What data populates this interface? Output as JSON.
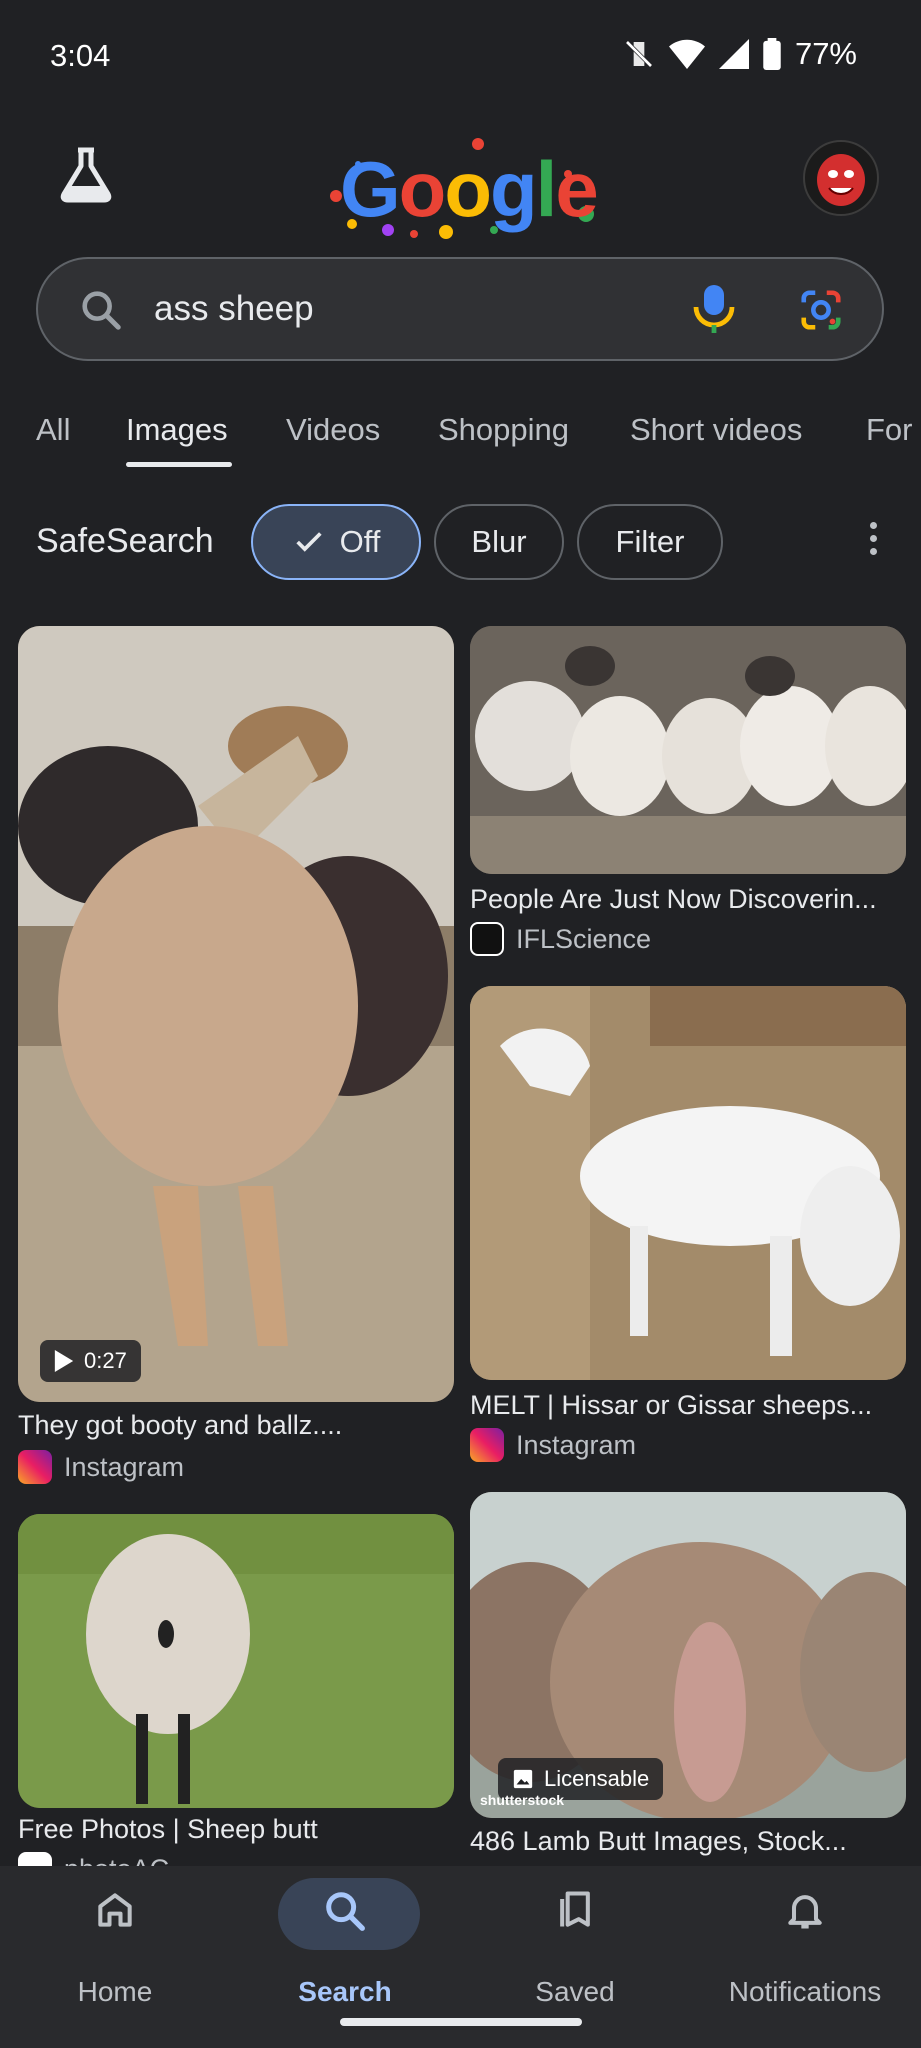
{
  "status_bar": {
    "time": "3:04",
    "battery": "77%"
  },
  "search": {
    "query": "ass sheep"
  },
  "tabs": [
    "All",
    "Images",
    "Videos",
    "Shopping",
    "Short videos",
    "For"
  ],
  "active_tab": "Images",
  "safesearch": {
    "label": "SafeSearch",
    "options": [
      "Off",
      "Blur",
      "Filter"
    ],
    "selected": "Off"
  },
  "results": [
    {
      "title": "They got booty and ballz....",
      "source": "Instagram",
      "badge": "0:27"
    },
    {
      "title": "People Are Just Now Discoverin...",
      "source": "IFLScience"
    },
    {
      "title": "MELT | Hissar or Gissar sheeps...",
      "source": "Instagram"
    },
    {
      "title": "Free Photos | Sheep butt",
      "source": "photoAC"
    },
    {
      "title": "486 Lamb Butt Images, Stock...",
      "badge": "Licensable",
      "watermark": "shutterstock"
    }
  ],
  "bottom_nav": [
    {
      "label": "Home",
      "icon": "home-icon"
    },
    {
      "label": "Search",
      "icon": "search-icon"
    },
    {
      "label": "Saved",
      "icon": "bookmark-icon"
    },
    {
      "label": "Notifications",
      "icon": "bell-icon"
    }
  ],
  "colors": {
    "background": "#202124",
    "accent": "#a8c7fa",
    "chip_selected": "#394457"
  }
}
